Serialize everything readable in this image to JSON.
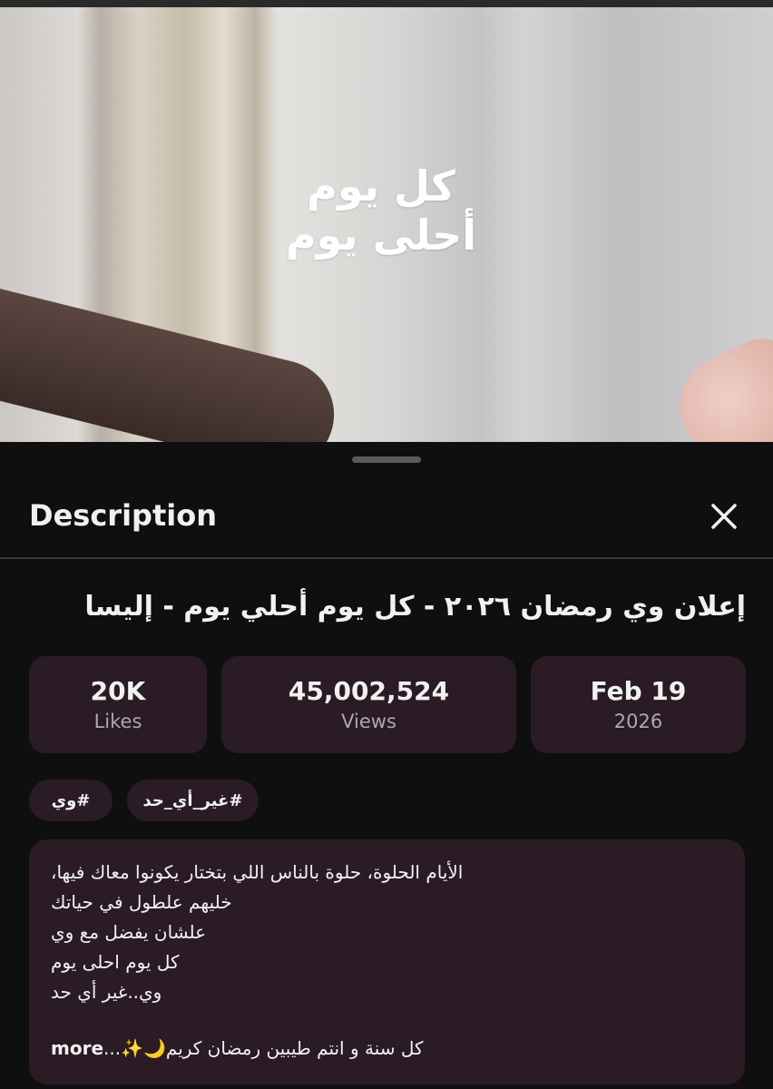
{
  "video": {
    "overlay_line1": "كل يوم",
    "overlay_line2": "أحلى يوم"
  },
  "sheet": {
    "title": "Description",
    "close_icon": "close-icon"
  },
  "video_title": "إعلان وي رمضان ٢٠٢٦ - كل يوم أحلي يوم - إليسا",
  "stats": {
    "likes": {
      "value": "20K",
      "label": "Likes"
    },
    "views": {
      "value": "45,002,524",
      "label": "Views"
    },
    "date": {
      "value": "Feb 19",
      "label": "2026"
    }
  },
  "tags": [
    "#وي",
    "#غير_أي_حد"
  ],
  "description": {
    "lines": [
      "الأيام الحلوة، حلوة بالناس اللي بتختار يكونوا معاك فيها،",
      "خليهم علطول في حياتك",
      "علشان يفضل مع وي",
      "كل يوم احلى يوم",
      "وي..غير أي حد"
    ],
    "last_line": "كل سنة و انتم طيبين رمضان كريم🌙✨...",
    "more_label": "more"
  },
  "colors": {
    "background": "#0f0f0f",
    "card": "#2b1b24",
    "text": "#f1f1f1",
    "muted": "#aaaaaa"
  }
}
